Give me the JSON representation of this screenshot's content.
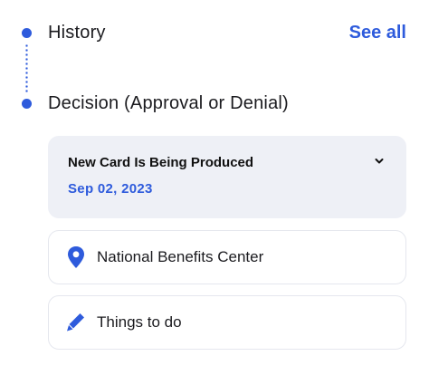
{
  "history": {
    "title": "History",
    "see_all": "See all"
  },
  "decision": {
    "title": "Decision (Approval or Denial)"
  },
  "status_card": {
    "title": "New Card Is Being Produced",
    "date": "Sep 02, 2023"
  },
  "office": {
    "label": "National Benefits Center",
    "icon": "location-pin-icon"
  },
  "todo": {
    "label": "Things to do",
    "icon": "pencil-icon"
  },
  "colors": {
    "accent": "#2e5bdc",
    "card_bg": "#eef0f6",
    "border": "#e5e7ee"
  }
}
